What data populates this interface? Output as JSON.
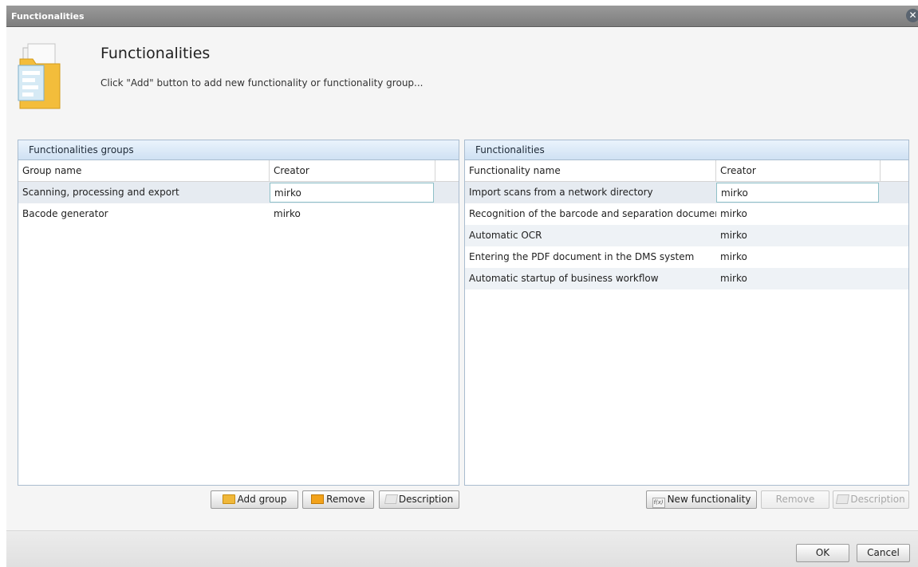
{
  "window": {
    "title": "Functionalities",
    "close_icon": "close-icon"
  },
  "header": {
    "title": "Functionalities",
    "subtitle": "Click \"Add\" button to add new functionality or functionality group...",
    "icon": "folder-documents-icon"
  },
  "groups_panel": {
    "title": "Functionalities groups",
    "columns": [
      "Group name",
      "Creator"
    ],
    "rows": [
      {
        "name": "Scanning, processing and export",
        "creator": "mirko"
      },
      {
        "name": "Bacode generator",
        "creator": "mirko"
      }
    ],
    "buttons": {
      "add": "Add group",
      "remove": "Remove",
      "description": "Description"
    }
  },
  "func_panel": {
    "title": "Functionalities",
    "columns": [
      "Functionality name",
      "Creator"
    ],
    "rows": [
      {
        "name": "Import scans from a network directory",
        "creator": "mirko"
      },
      {
        "name": "Recognition of the barcode and separation documents",
        "creator": "mirko"
      },
      {
        "name": "Automatic OCR",
        "creator": "mirko"
      },
      {
        "name": "Entering the PDF document in the DMS system",
        "creator": "mirko"
      },
      {
        "name": "Automatic startup  of business workflow",
        "creator": "mirko"
      }
    ],
    "buttons": {
      "new": "New functionality",
      "remove": "Remove",
      "description": "Description"
    }
  },
  "footer": {
    "ok": "OK",
    "cancel": "Cancel"
  },
  "colors": {
    "panel_header": "#cfe1f3",
    "titlebar": "#8a8a8a",
    "selected_cell_border": "#8fc0c8"
  }
}
